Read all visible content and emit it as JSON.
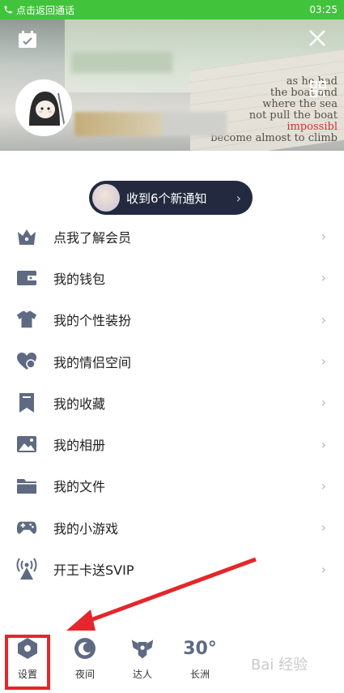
{
  "status_bar": {
    "call_text": "点击返回通话",
    "time": "03:25"
  },
  "header": {
    "paper_lines": [
      "as he had",
      "the boat and",
      "where the sea",
      "not pull the boat",
      "impossibl",
      "become almost to climb"
    ]
  },
  "notification": {
    "text": "收到6个新通知"
  },
  "menu": {
    "items": [
      {
        "label": "点我了解会员",
        "icon": "vip-crown-icon"
      },
      {
        "label": "我的钱包",
        "icon": "wallet-icon"
      },
      {
        "label": "我的个性装扮",
        "icon": "tshirt-icon"
      },
      {
        "label": "我的情侣空间",
        "icon": "heart-icon"
      },
      {
        "label": "我的收藏",
        "icon": "bookmark-icon"
      },
      {
        "label": "我的相册",
        "icon": "photo-icon"
      },
      {
        "label": "我的文件",
        "icon": "folder-icon"
      },
      {
        "label": "我的小游戏",
        "icon": "gamepad-icon"
      },
      {
        "label": "开王卡送SVIP",
        "icon": "broadcast-tower-icon"
      }
    ]
  },
  "bottom": {
    "settings": "设置",
    "night": "夜间",
    "talent": "达人",
    "weather_temp": "30°",
    "weather_city": "长洲"
  },
  "watermark": "Bai 经验",
  "colors": {
    "status_green": "#41c43b",
    "notif_bg": "#232a3f",
    "icon_gray": "#5f6a82",
    "highlight_red": "#e3272b"
  }
}
